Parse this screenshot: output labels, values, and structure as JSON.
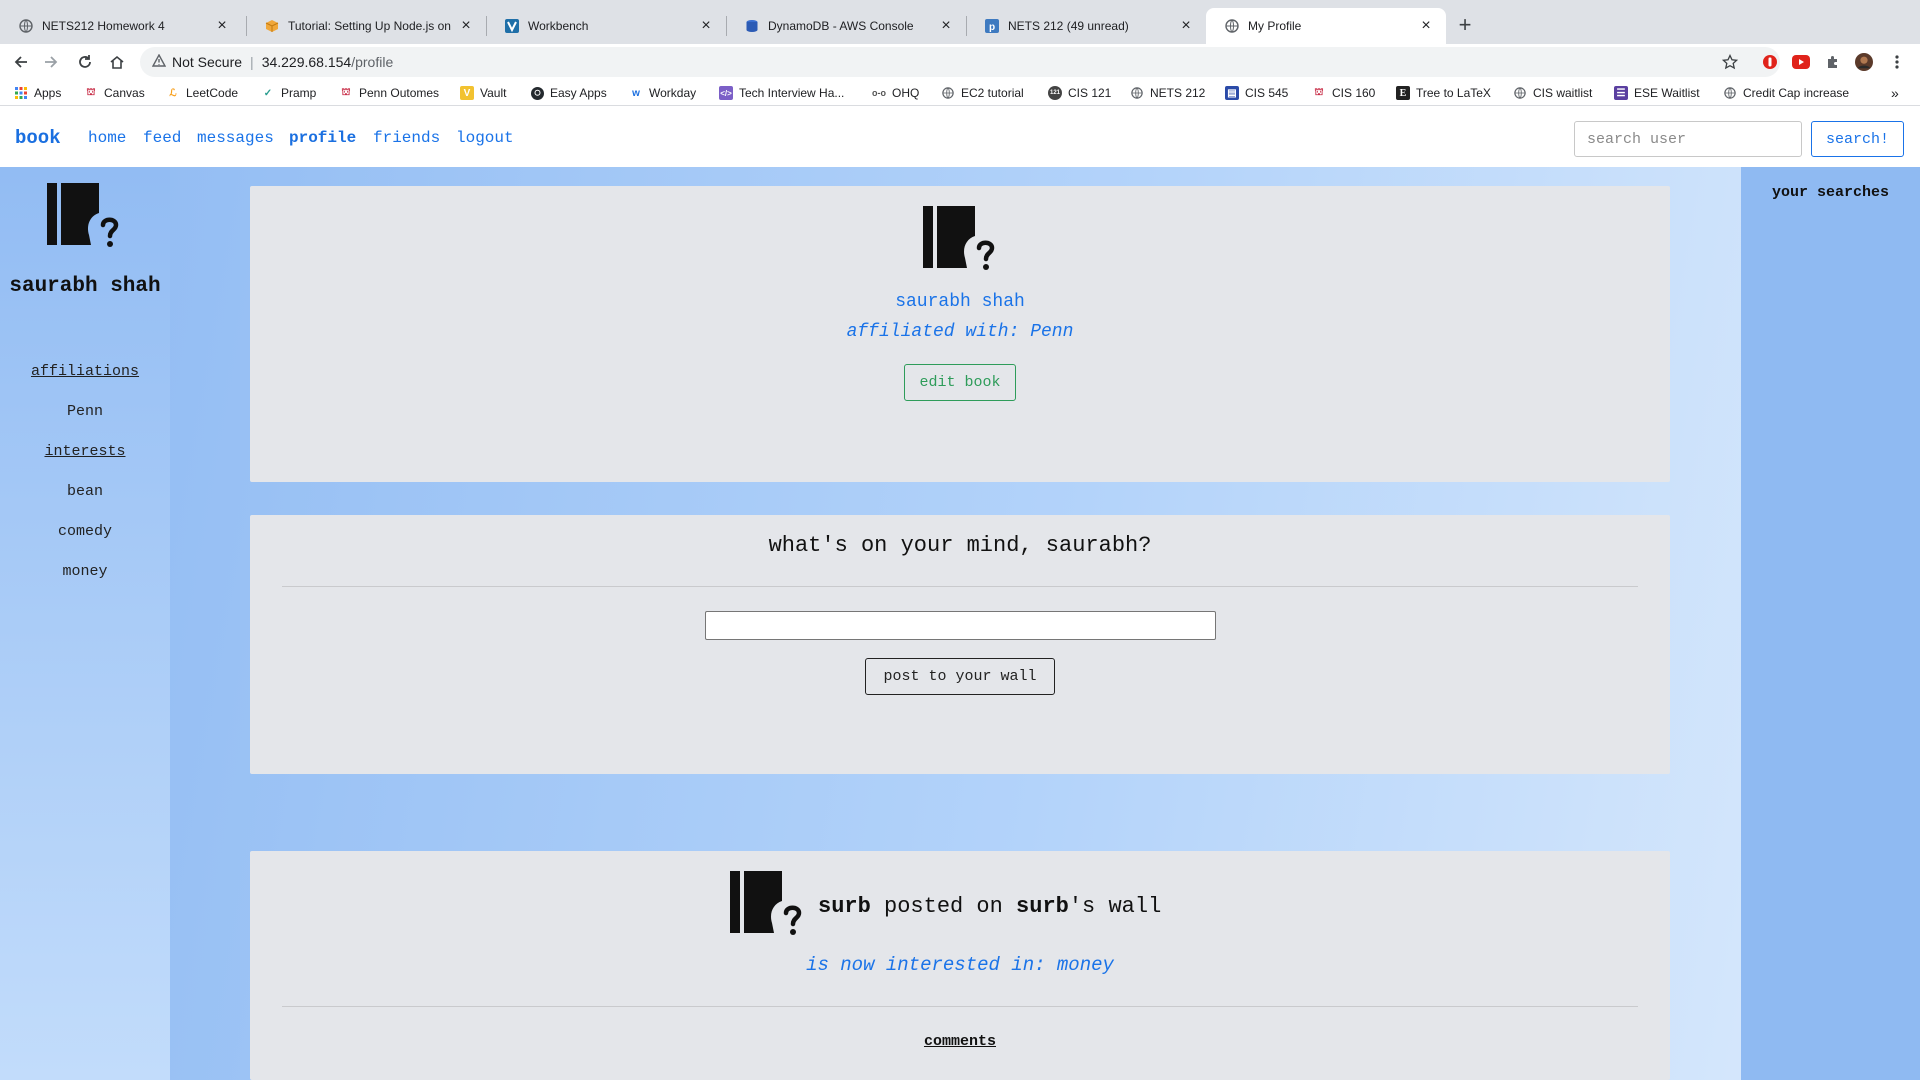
{
  "browser": {
    "tabs": [
      {
        "title": "NETS212 Homework 4",
        "icon": "globe-icon"
      },
      {
        "title": "Tutorial: Setting Up Node.js on",
        "icon": "aws-box-icon"
      },
      {
        "title": "Workbench",
        "icon": "vocareum-icon"
      },
      {
        "title": "DynamoDB - AWS Console",
        "icon": "dynamodb-icon"
      },
      {
        "title": "NETS 212 (49 unread)",
        "icon": "piazza-icon"
      },
      {
        "title": "My Profile",
        "icon": "globe-icon"
      }
    ],
    "address": {
      "security_label": "Not Secure",
      "host": "34.229.68.154",
      "path": "/profile"
    },
    "bookmarks": [
      "Apps",
      "Canvas",
      "LeetCode",
      "Pramp",
      "Penn Outomes",
      "Vault",
      "Easy Apps",
      "Workday",
      "Tech Interview Ha...",
      "OHQ",
      "EC2 tutorial",
      "CIS 121",
      "NETS 212",
      "CIS 545",
      "CIS 160",
      "Tree to LaTeX",
      "CIS waitlist",
      "ESE Waitlist",
      "Credit Cap increase"
    ],
    "more_bookmarks": "»"
  },
  "site": {
    "brand": "book",
    "nav": {
      "home": "home",
      "feed": "feed",
      "messages": "messages",
      "profile": "profile",
      "friends": "friends",
      "logout": "logout"
    },
    "search": {
      "placeholder": "search user",
      "button": "search!"
    }
  },
  "sidebar": {
    "name": "saurabh shah",
    "affiliations_label": "affiliations",
    "affiliations": [
      "Penn"
    ],
    "interests_label": "interests",
    "interests": [
      "bean",
      "comedy",
      "money"
    ]
  },
  "right_sidebar": {
    "title": "your searches"
  },
  "profile_card": {
    "name": "saurabh shah",
    "affiliation": "affiliated with: Penn",
    "edit_button": "edit book"
  },
  "post_card": {
    "prompt": "what's on your mind, saurabh?",
    "button": "post to your wall"
  },
  "wall_post": {
    "author": "surb",
    "verb": " posted on ",
    "target": "surb",
    "suffix": "'s wall",
    "status": "is now interested in: money",
    "comments_label": "comments"
  },
  "colors": {
    "accent": "#1a73e8",
    "edit_green": "#2e9c5a",
    "card_bg": "#e4e6ea",
    "page_gradient_start": "#8fbaf2",
    "page_gradient_end": "#dcebfc"
  }
}
